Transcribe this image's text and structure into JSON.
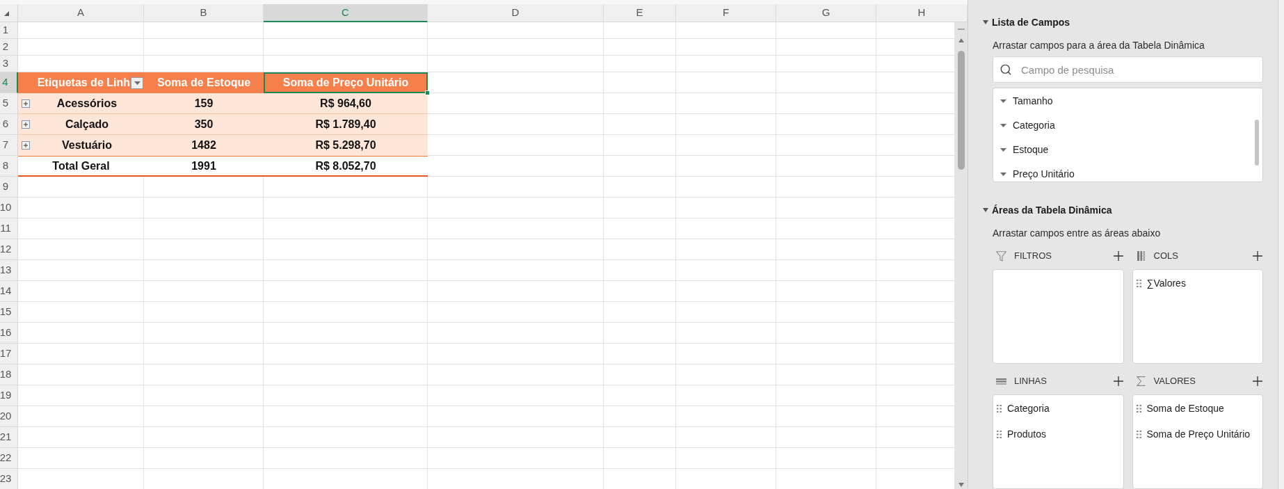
{
  "spreadsheet": {
    "columns": [
      {
        "label": "A",
        "selected": false
      },
      {
        "label": "B",
        "selected": false
      },
      {
        "label": "C",
        "selected": true
      },
      {
        "label": "D",
        "selected": false
      },
      {
        "label": "E",
        "selected": false
      },
      {
        "label": "F",
        "selected": false
      },
      {
        "label": "G",
        "selected": false
      },
      {
        "label": "H",
        "selected": false
      }
    ],
    "rows": [
      {
        "label": "1",
        "selected": false
      },
      {
        "label": "2",
        "selected": false
      },
      {
        "label": "3",
        "selected": false
      },
      {
        "label": "4",
        "selected": true
      },
      {
        "label": "5",
        "selected": false
      },
      {
        "label": "6",
        "selected": false
      },
      {
        "label": "7",
        "selected": false
      },
      {
        "label": "8",
        "selected": false
      },
      {
        "label": "9",
        "selected": false
      },
      {
        "label": "10",
        "selected": false
      },
      {
        "label": "11",
        "selected": false
      },
      {
        "label": "12",
        "selected": false
      },
      {
        "label": "13",
        "selected": false
      },
      {
        "label": "14",
        "selected": false
      },
      {
        "label": "15",
        "selected": false
      },
      {
        "label": "16",
        "selected": false
      },
      {
        "label": "17",
        "selected": false
      },
      {
        "label": "18",
        "selected": false
      },
      {
        "label": "19",
        "selected": false
      },
      {
        "label": "20",
        "selected": false
      },
      {
        "label": "21",
        "selected": false
      },
      {
        "label": "22",
        "selected": false
      },
      {
        "label": "23",
        "selected": false
      }
    ],
    "pivot_table": {
      "headers": [
        {
          "text": "Etiquetas de Linh",
          "selected": false,
          "filter_button": true
        },
        {
          "text": "Soma de Estoque",
          "selected": false,
          "filter_button": false
        },
        {
          "text": "Soma de Preço Unitário",
          "selected": true,
          "filter_button": false
        }
      ],
      "rows": [
        {
          "expanded": false,
          "cells": [
            "Acessórios",
            "159",
            "R$ 964,60"
          ]
        },
        {
          "expanded": false,
          "cells": [
            "Calçado",
            "350",
            "R$ 1.789,40"
          ]
        },
        {
          "expanded": false,
          "cells": [
            "Vestuário",
            "1482",
            "R$ 5.298,70"
          ]
        }
      ],
      "total": [
        "Total Geral",
        "1991",
        "R$ 8.052,70"
      ]
    }
  },
  "pivot_panel": {
    "field_list": {
      "title": "Lista de Campos",
      "expanded": true,
      "hint": "Arrastar campos para a área da Tabela Dinâmica",
      "search": {
        "placeholder": "Campo de pesquisa"
      },
      "fields": [
        "Tamanho",
        "Categoria",
        "Estoque",
        "Preço Unitário"
      ]
    },
    "areas": {
      "title": "Áreas da Tabela Dinâmica",
      "expanded": true,
      "hint": "Arrastar campos entre as áreas abaixo",
      "sections": [
        {
          "kind": "filters",
          "label": "FILTROS"
        },
        {
          "kind": "columns",
          "label": "COLS",
          "items": [
            "∑Valores"
          ]
        },
        {
          "kind": "rows",
          "label": "LINHAS",
          "items": [
            "Categoria",
            "Produtos"
          ]
        },
        {
          "kind": "values",
          "label": "VALORES",
          "items": [
            "Soma de Estoque",
            "Soma de Preço Unitário"
          ]
        }
      ]
    }
  }
}
